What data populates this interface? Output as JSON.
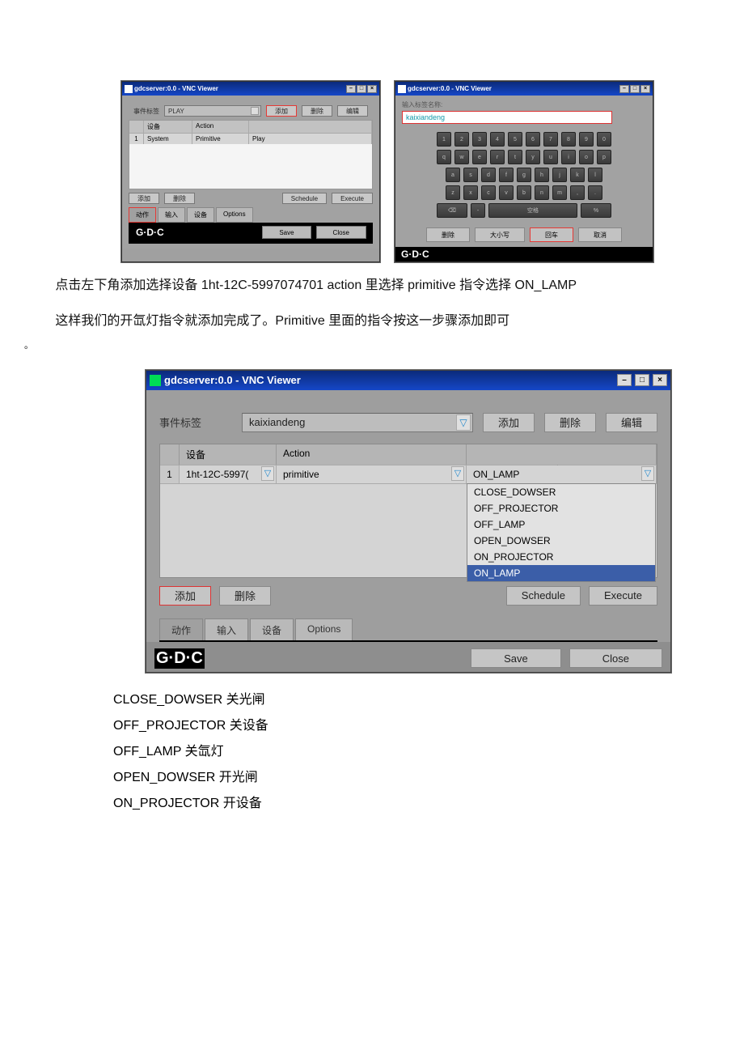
{
  "thumb_a": {
    "titlebar": "gdcserver:0.0 - VNC Viewer",
    "event_label": "事件标签",
    "event_value": "PLAY",
    "add": "添加",
    "del": "删除",
    "edit": "编辑",
    "hdr_dev": "设备",
    "hdr_act": "Action",
    "row_dev": "System",
    "row_act": "Primitive",
    "row_cmd": "Play",
    "btn_schedule": "Schedule",
    "btn_execute": "Execute",
    "tab_action": "动作",
    "tab_input": "输入",
    "tab_device": "设备",
    "tab_options": "Options",
    "save": "Save",
    "close": "Close"
  },
  "thumb_b": {
    "titlebar": "gdcserver:0.0 - VNC Viewer",
    "label": "输入标签名称:",
    "value": "kaixiandeng",
    "keys_r1": [
      "1",
      "2",
      "3",
      "4",
      "5",
      "6",
      "7",
      "8",
      "9",
      "0"
    ],
    "keys_r2": [
      "q",
      "w",
      "e",
      "r",
      "t",
      "y",
      "u",
      "i",
      "o",
      "p"
    ],
    "keys_r3": [
      "a",
      "s",
      "d",
      "f",
      "g",
      "h",
      "j",
      "k",
      "l"
    ],
    "keys_r4": [
      "z",
      "x",
      "c",
      "v",
      "b",
      "n",
      "m",
      ",",
      "."
    ],
    "space": "空格",
    "back": "⌫",
    "pct": "%",
    "del": "删除",
    "case": "大小写",
    "go": "回车",
    "cancel": "取消"
  },
  "para1": "点击左下角添加选择设备 1ht-12C-5997074701 action 里选择 primitive 指令选择 ON_LAMP",
  "para2_a": "这样我们的开氙灯指令就添加完成了。Primitive 里面的指令按这一步骤添加即可",
  "para2_b": "。",
  "big": {
    "titlebar": "gdcserver:0.0 - VNC Viewer",
    "event_label": "事件标签",
    "event_value": "kaixiandeng",
    "add": "添加",
    "del": "删除",
    "edit": "编辑",
    "hdr_dev": "设备",
    "hdr_act": "Action",
    "row_n": "1",
    "row_dev": "1ht-12C-5997(",
    "row_act": "primitive",
    "row_cmd": "ON_LAMP",
    "options": [
      "CLOSE_DOWSER",
      "OFF_PROJECTOR",
      "OFF_LAMP",
      "OPEN_DOWSER",
      "ON_PROJECTOR",
      "ON_LAMP"
    ],
    "btn_schedule": "Schedule",
    "btn_execute": "Execute",
    "tab_action": "动作",
    "tab_input": "输入",
    "tab_device": "设备",
    "tab_options": "Options",
    "save": "Save",
    "close": "Close"
  },
  "defs": [
    "CLOSE_DOWSER 关光闸",
    "OFF_PROJECTOR 关设备",
    "OFF_LAMP 关氙灯",
    "OPEN_DOWSER 开光闸",
    "ON_PROJECTOR 开设备"
  ],
  "logo": "G·D·C"
}
